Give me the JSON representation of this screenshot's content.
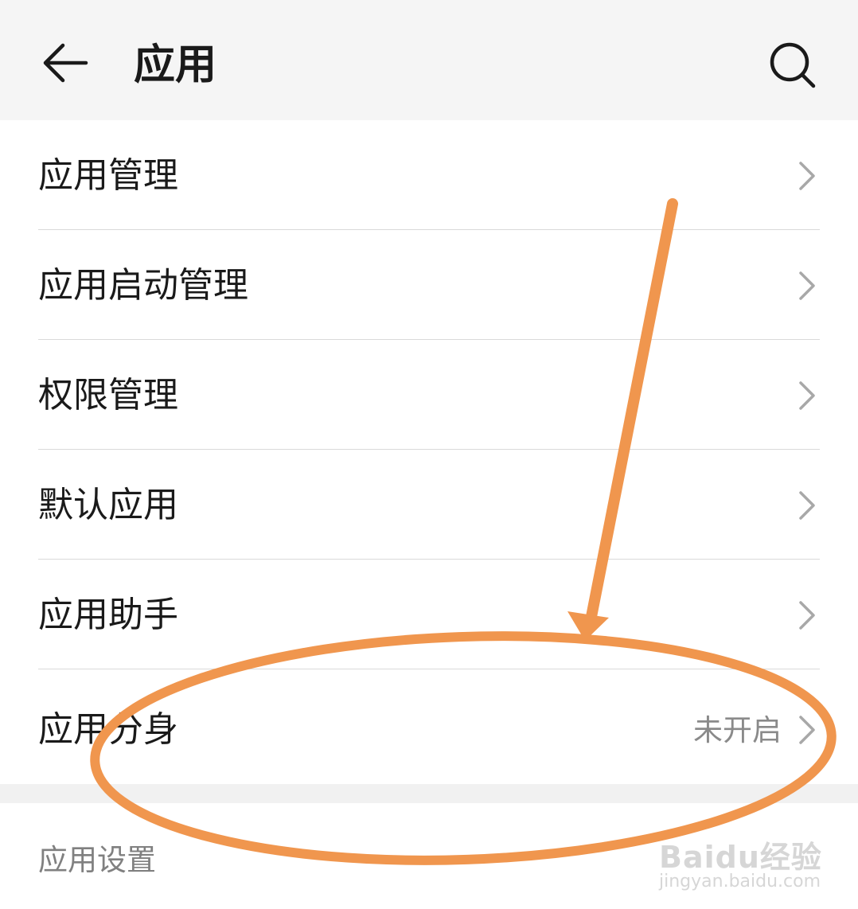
{
  "header": {
    "title": "应用",
    "back_icon": "arrow-left-icon",
    "search_icon": "search-icon"
  },
  "list": {
    "items": [
      {
        "label": "应用管理",
        "value": ""
      },
      {
        "label": "应用启动管理",
        "value": ""
      },
      {
        "label": "权限管理",
        "value": ""
      },
      {
        "label": "默认应用",
        "value": ""
      },
      {
        "label": "应用助手",
        "value": ""
      },
      {
        "label": "应用分身",
        "value": "未开启"
      }
    ]
  },
  "section": {
    "title": "应用设置"
  },
  "annotation": {
    "color": "#f0964e"
  },
  "watermark": {
    "logo": "Baidu经验",
    "url": "jingyan.baidu.com"
  }
}
